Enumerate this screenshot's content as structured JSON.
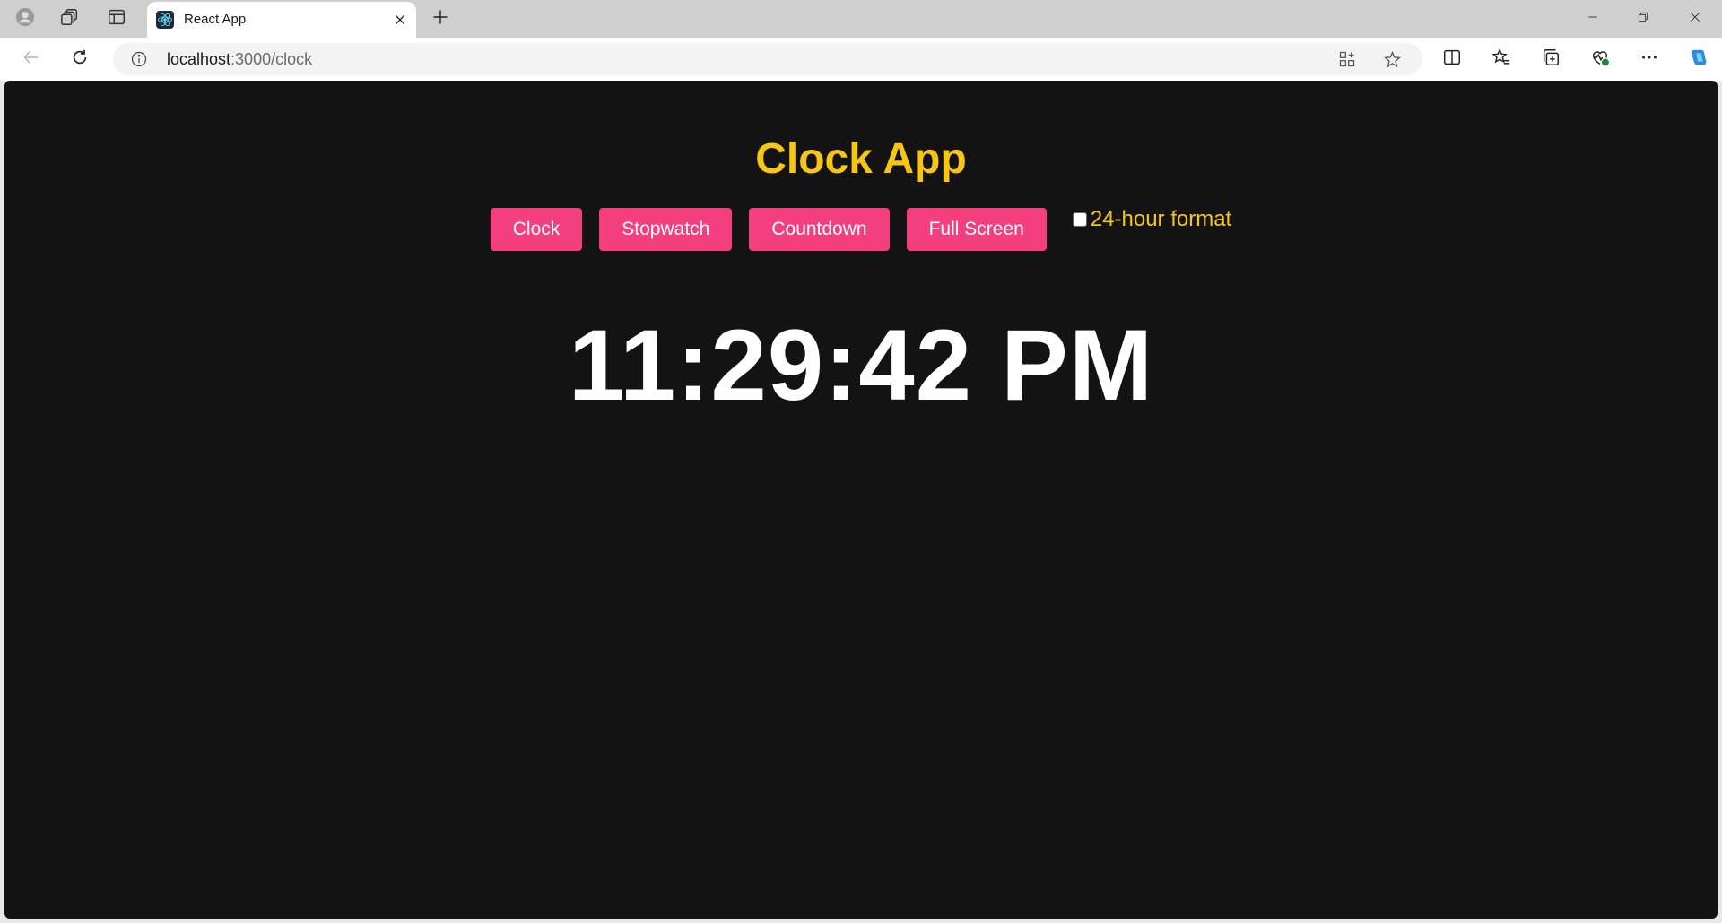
{
  "browser": {
    "tab_title": "React App",
    "url_host": "localhost",
    "url_path": ":3000/clock",
    "icons": {
      "profile": "profile-icon",
      "workspaces": "workspaces-icon",
      "vertical_tabs": "vertical-tabs-icon",
      "back": "back-arrow-icon",
      "reload": "reload-icon",
      "site_info": "info-icon",
      "app_available": "app-available-icon",
      "favorite": "star-icon",
      "split_screen": "split-screen-icon",
      "favorites": "favorites-icon",
      "collections": "collections-icon",
      "performance": "performance-icon",
      "more": "more-icon",
      "copilot": "copilot-icon"
    }
  },
  "app": {
    "title": "Clock App",
    "buttons": {
      "clock": "Clock",
      "stopwatch": "Stopwatch",
      "countdown": "Countdown",
      "fullscreen": "Full Screen"
    },
    "format_label": "24-hour format",
    "format_checked": false,
    "time": "11:29:42 PM"
  },
  "colors": {
    "background": "#131313",
    "accent_yellow": "#f5c518",
    "button_pink": "#f43f7f",
    "clock_text": "#ffffff"
  }
}
